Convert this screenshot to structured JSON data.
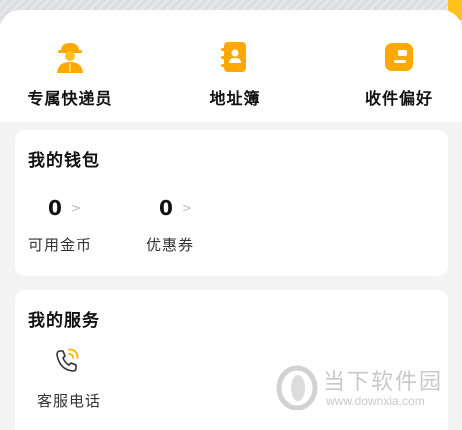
{
  "quick_actions": [
    {
      "label": "专属快递员",
      "icon": "courier-icon"
    },
    {
      "label": "地址簿",
      "icon": "address-book-icon"
    },
    {
      "label": "收件偏好",
      "icon": "package-preference-icon"
    }
  ],
  "wallet": {
    "title": "我的钱包",
    "items": [
      {
        "value": "0",
        "label": "可用金币"
      },
      {
        "value": "0",
        "label": "优惠券"
      }
    ]
  },
  "services": {
    "title": "我的服务",
    "items": [
      {
        "label": "客服电话",
        "icon": "phone-call-icon"
      }
    ]
  },
  "watermark": {
    "text": "当下软件园",
    "url": "www.downxia.com"
  },
  "colors": {
    "accent": "#ffb400",
    "page_bg": "#f4f4f4"
  }
}
